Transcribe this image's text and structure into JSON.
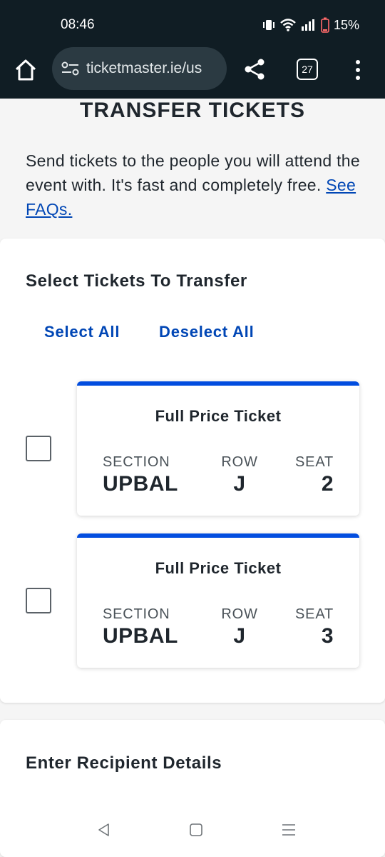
{
  "status_bar": {
    "time": "08:46",
    "battery": "15%"
  },
  "browser": {
    "url": "ticketmaster.ie/us",
    "tab_count": "27"
  },
  "page": {
    "title": "TRANSFER TICKETS",
    "intro_text": "Send tickets to the people you will attend the event with. It's fast and completely free.",
    "faq_link": "See FAQs."
  },
  "select_section": {
    "heading": "Select Tickets To Transfer",
    "select_all": "Select All",
    "deselect_all": "Deselect All",
    "tickets": [
      {
        "title": "Full Price Ticket",
        "section_label": "SECTION",
        "section": "UPBAL",
        "row_label": "ROW",
        "row": "J",
        "seat_label": "SEAT",
        "seat": "2",
        "checked": false
      },
      {
        "title": "Full Price Ticket",
        "section_label": "SECTION",
        "section": "UPBAL",
        "row_label": "ROW",
        "row": "J",
        "seat_label": "SEAT",
        "seat": "3",
        "checked": false
      }
    ]
  },
  "recipient_section": {
    "heading": "Enter Recipient Details"
  },
  "colors": {
    "accent": "#024ddf",
    "link": "#0046b5",
    "chrome": "#101d24"
  },
  "icons": {
    "home": "home-icon",
    "site_settings": "tune-icon",
    "share": "share-icon",
    "menu": "more-vert-icon",
    "back": "back-triangle-icon",
    "home_nav": "square-icon",
    "recents": "recents-lines-icon"
  }
}
